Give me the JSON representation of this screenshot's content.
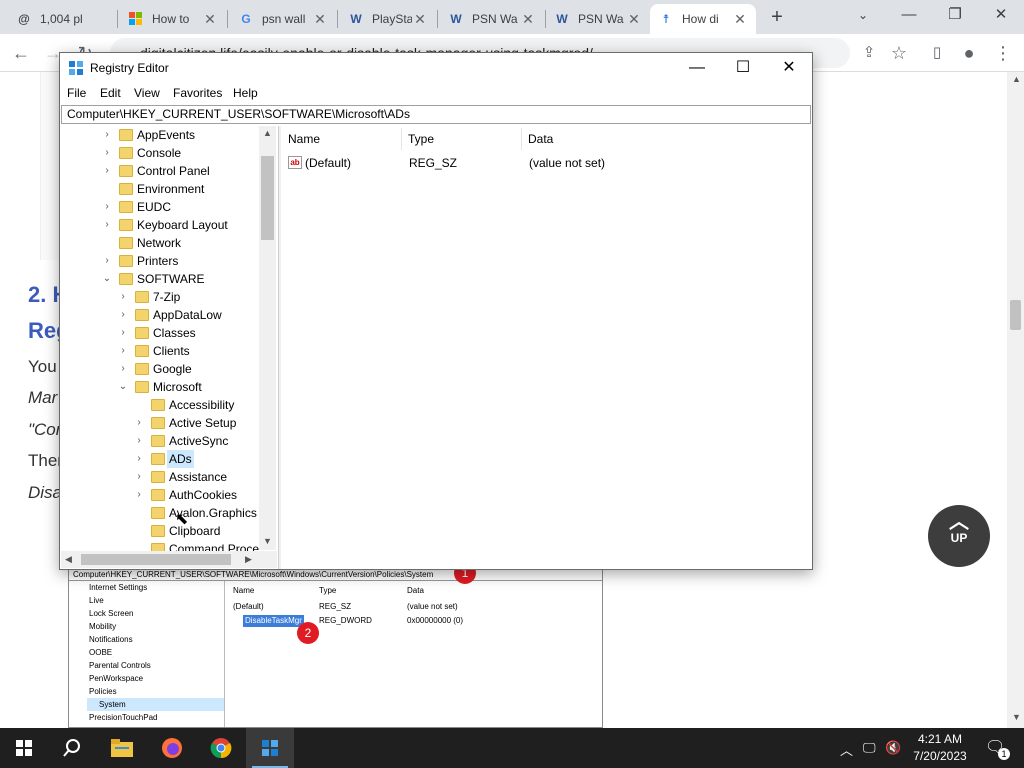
{
  "browser": {
    "tabs": [
      {
        "title": "1,004 pl",
        "icon": "threads-icon"
      },
      {
        "title": "How to",
        "icon": "microsoft-icon"
      },
      {
        "title": "psn wall",
        "icon": "google-icon"
      },
      {
        "title": "PlayStat",
        "icon": "word-icon"
      },
      {
        "title": "PSN Wa",
        "icon": "word-icon"
      },
      {
        "title": "PSN Wa",
        "icon": "word-icon"
      },
      {
        "title": "How di",
        "icon": "digitalcitizen-icon"
      }
    ],
    "url": "digitalcitizen.life/easily-enable-or-disable-task-manager-using-taskmgrod/"
  },
  "article": {
    "heading_lines": [
      "2. H",
      "Reg"
    ],
    "body_lines": [
      "You",
      "Mar",
      "\"Cor",
      "Ther",
      "Disa"
    ],
    "up_button": "UP"
  },
  "article_image": {
    "address": "Computer\\HKEY_CURRENT_USER\\SOFTWARE\\Microsoft\\Windows\\CurrentVersion\\Policies\\System",
    "tree_items": [
      "Internet Settings",
      "Live",
      "Lock Screen",
      "Mobility",
      "Notifications",
      "OOBE",
      "Parental Controls",
      "PenWorkspace",
      "Policies",
      "System",
      "PrecisionTouchPad"
    ],
    "columns": [
      "Name",
      "Type",
      "Data"
    ],
    "rows": [
      {
        "name": "(Default)",
        "type": "REG_SZ",
        "data": "(value not set)"
      },
      {
        "name": "DisableTaskMgr",
        "type": "REG_DWORD",
        "data": "0x00000000 (0)"
      }
    ],
    "badges": [
      "1",
      "2"
    ]
  },
  "regedit": {
    "title": "Registry Editor",
    "menu": [
      "File",
      "Edit",
      "View",
      "Favorites",
      "Help"
    ],
    "address": "Computer\\HKEY_CURRENT_USER\\SOFTWARE\\Microsoft\\ADs",
    "tree": [
      {
        "label": "AppEvents",
        "expander": "›"
      },
      {
        "label": "Console",
        "expander": "›"
      },
      {
        "label": "Control Panel",
        "expander": "›"
      },
      {
        "label": "Environment",
        "expander": ""
      },
      {
        "label": "EUDC",
        "expander": "›"
      },
      {
        "label": "Keyboard Layout",
        "expander": "›"
      },
      {
        "label": "Network",
        "expander": ""
      },
      {
        "label": "Printers",
        "expander": "›"
      },
      {
        "label": "SOFTWARE",
        "expander": "⌄"
      },
      {
        "label": "7-Zip",
        "expander": "›"
      },
      {
        "label": "AppDataLow",
        "expander": "›"
      },
      {
        "label": "Classes",
        "expander": "›"
      },
      {
        "label": "Clients",
        "expander": "›"
      },
      {
        "label": "Google",
        "expander": "›"
      },
      {
        "label": "Microsoft",
        "expander": "⌄"
      },
      {
        "label": "Accessibility",
        "expander": ""
      },
      {
        "label": "Active Setup",
        "expander": "›"
      },
      {
        "label": "ActiveSync",
        "expander": "›"
      },
      {
        "label": "ADs",
        "expander": "›"
      },
      {
        "label": "Assistance",
        "expander": "›"
      },
      {
        "label": "AuthCookies",
        "expander": "›"
      },
      {
        "label": "Avalon.Graphics",
        "expander": ""
      },
      {
        "label": "Clipboard",
        "expander": ""
      },
      {
        "label": "Command Proce",
        "expander": ""
      }
    ],
    "columns": [
      "Name",
      "Type",
      "Data"
    ],
    "values": [
      {
        "name": "(Default)",
        "type": "REG_SZ",
        "data": "(value not set)",
        "icon": "string-value-icon"
      }
    ]
  },
  "taskbar": {
    "apps": [
      "start-icon",
      "search-icon",
      "file-explorer-icon",
      "firefox-icon",
      "chrome-icon",
      "regedit-icon"
    ],
    "time": "4:21 AM",
    "date": "7/20/2023",
    "notification_count": "1"
  }
}
